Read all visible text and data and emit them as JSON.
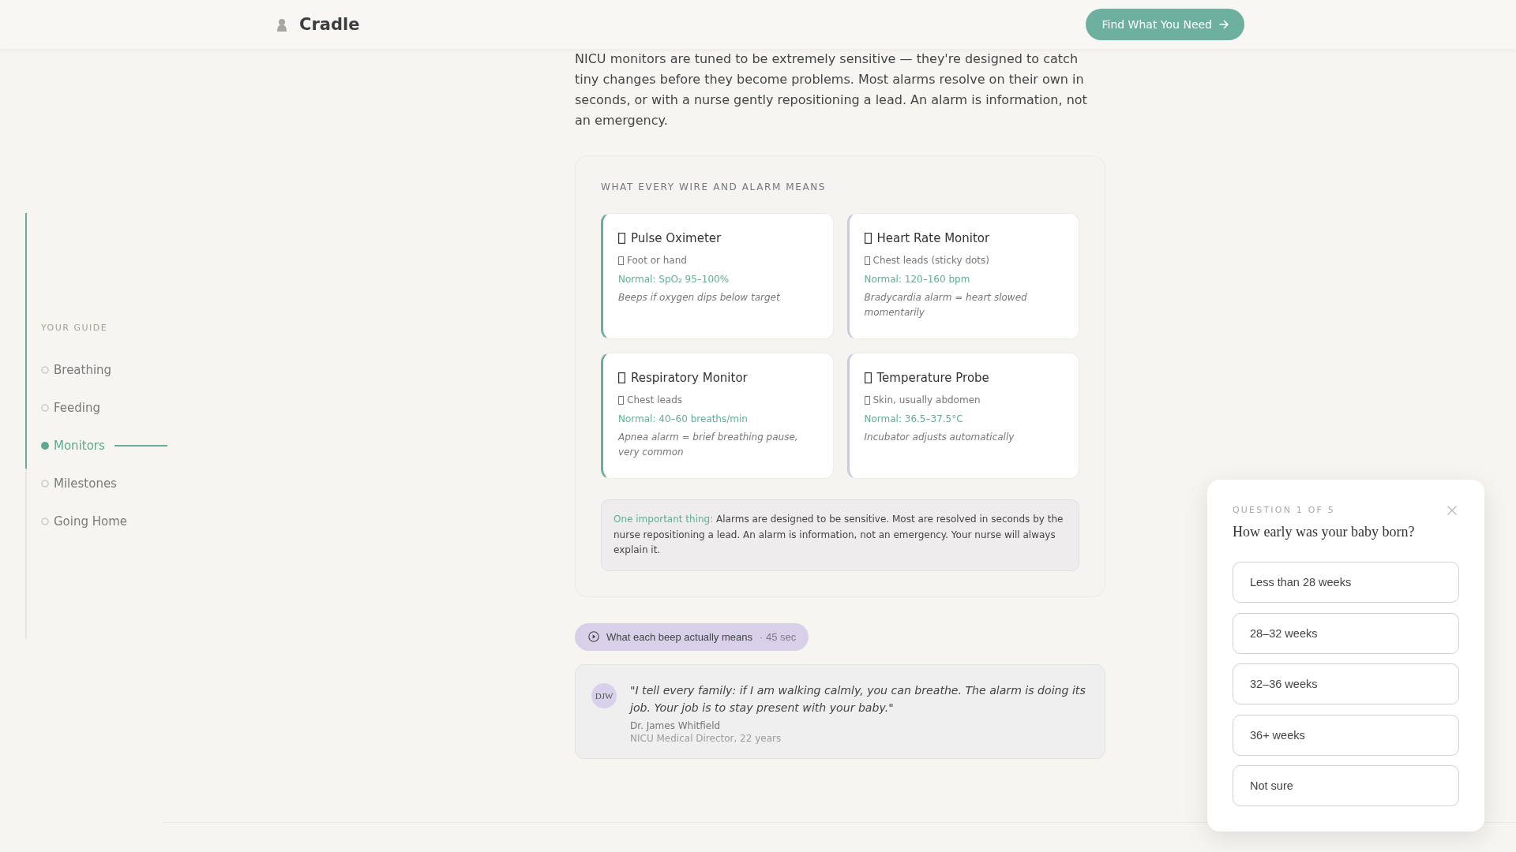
{
  "header": {
    "logo": "Cradle",
    "cta": "Find What You Need"
  },
  "sidebar": {
    "progress": {
      "level": 0.6
    },
    "heading": "YOUR GUIDE",
    "items": [
      {
        "label": "Breathing",
        "selected": false
      },
      {
        "label": "Feeding",
        "selected": false
      },
      {
        "label": "Monitors",
        "selected": true
      },
      {
        "label": "Milestones",
        "selected": false
      },
      {
        "label": "Going Home",
        "selected": false
      }
    ]
  },
  "article": {
    "intro": "NICU monitors are tuned to be extremely sensitive — they're designed to catch tiny changes before they become problems. Most alarms resolve on their own in seconds, or with a nurse gently repositioning a lead. An alarm is information, not an emergency.",
    "guide_card": {
      "title": "WHAT EVERY WIRE AND ALARM MEANS",
      "monitors": [
        {
          "name": "Pulse Oximeter",
          "placement": "Foot or hand",
          "normal": "Normal: SpO₂ 95–100%",
          "note": "Beeps if oxygen dips below target",
          "color": "#6aae98"
        },
        {
          "name": "Heart Rate Monitor",
          "placement": "Chest leads (sticky dots)",
          "normal": "Normal: 120–160 bpm",
          "note": "Bradycardia alarm = heart slowed momentarily",
          "color": "#cdc7e4"
        },
        {
          "name": "Respiratory Monitor",
          "placement": "Chest leads",
          "normal": "Normal: 40–60 breaths/min",
          "note": "Apnea alarm = brief breathing pause, very common",
          "color": "#6aae98"
        },
        {
          "name": "Temperature Probe",
          "placement": "Skin, usually abdomen",
          "normal": "Normal: 36.5–37.5°C",
          "note": "Incubator adjusts automatically",
          "color": "#cdc7e4"
        }
      ],
      "callout": {
        "lead": "One important thing:",
        "text": "Alarms are designed to be sensitive. Most are resolved in seconds by the nurse repositioning a lead. An alarm is information, not an emergency. Your nurse will always explain it."
      }
    },
    "video": {
      "label": "What each beep actually means",
      "duration": "· 45 sec"
    },
    "quote": {
      "initials": "DJW",
      "text": "\"I tell every family: if I am walking calmly, you can breathe. The alarm is doing its job. Your job is to stay present with your baby.\"",
      "author": "Dr. James Whitfield",
      "role": "NICU Medical Director, 22 years"
    }
  },
  "quiz": {
    "step": "QUESTION 1 OF 5",
    "question": "How early was your baby born?",
    "options": [
      {
        "label": "Less than 28 weeks",
        "selected": false
      },
      {
        "label": "28–32 weeks",
        "selected": false
      },
      {
        "label": "32–36 weeks",
        "selected": false
      },
      {
        "label": "36+ weeks",
        "selected": false
      },
      {
        "label": "Not sure",
        "selected": false
      }
    ]
  }
}
